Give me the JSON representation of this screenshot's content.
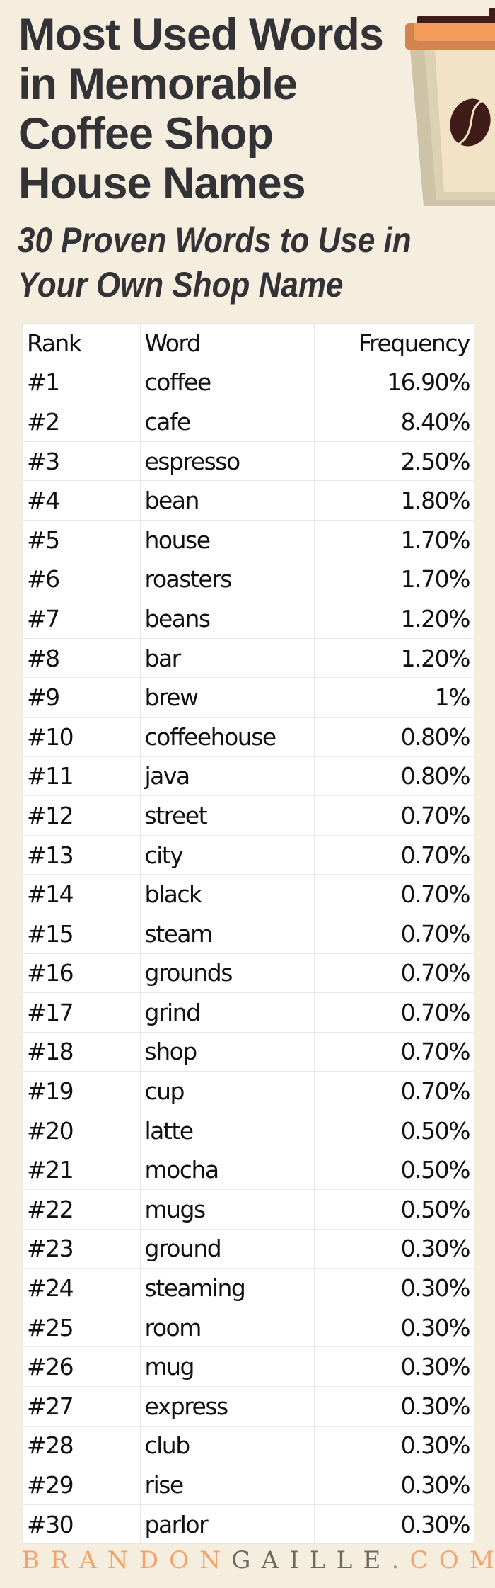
{
  "header": {
    "title_lines": [
      "Most Used Words",
      "in Memorable",
      "Coffee Shop",
      "House Names"
    ],
    "subtitle_lines": [
      "30 Proven Words to Use in",
      "Your Own Shop Name"
    ],
    "illustration": "coffee-cup-icon"
  },
  "colors": {
    "background": "#f5eedf",
    "title": "#333337",
    "accent_orange": "#f4a26b",
    "footer_gray": "#6d6860",
    "bean": "#3f1c17"
  },
  "table": {
    "columns": [
      "Rank",
      "Word",
      "Frequency"
    ],
    "rows": [
      {
        "rank": "#1",
        "word": "coffee",
        "frequency": "16.90%"
      },
      {
        "rank": "#2",
        "word": "cafe",
        "frequency": "8.40%"
      },
      {
        "rank": "#3",
        "word": "espresso",
        "frequency": "2.50%"
      },
      {
        "rank": "#4",
        "word": "bean",
        "frequency": "1.80%"
      },
      {
        "rank": "#5",
        "word": "house",
        "frequency": "1.70%"
      },
      {
        "rank": "#6",
        "word": "roasters",
        "frequency": "1.70%"
      },
      {
        "rank": "#7",
        "word": "beans",
        "frequency": "1.20%"
      },
      {
        "rank": "#8",
        "word": "bar",
        "frequency": "1.20%"
      },
      {
        "rank": "#9",
        "word": "brew",
        "frequency": "1%"
      },
      {
        "rank": "#10",
        "word": "coffeehouse",
        "frequency": "0.80%"
      },
      {
        "rank": "#11",
        "word": "java",
        "frequency": "0.80%"
      },
      {
        "rank": "#12",
        "word": "street",
        "frequency": "0.70%"
      },
      {
        "rank": "#13",
        "word": "city",
        "frequency": "0.70%"
      },
      {
        "rank": "#14",
        "word": "black",
        "frequency": "0.70%"
      },
      {
        "rank": "#15",
        "word": "steam",
        "frequency": "0.70%"
      },
      {
        "rank": "#16",
        "word": "grounds",
        "frequency": "0.70%"
      },
      {
        "rank": "#17",
        "word": "grind",
        "frequency": "0.70%"
      },
      {
        "rank": "#18",
        "word": "shop",
        "frequency": "0.70%"
      },
      {
        "rank": "#19",
        "word": "cup",
        "frequency": "0.70%"
      },
      {
        "rank": "#20",
        "word": "latte",
        "frequency": "0.50%"
      },
      {
        "rank": "#21",
        "word": "mocha",
        "frequency": "0.50%"
      },
      {
        "rank": "#22",
        "word": "mugs",
        "frequency": "0.50%"
      },
      {
        "rank": "#23",
        "word": "ground",
        "frequency": "0.30%"
      },
      {
        "rank": "#24",
        "word": "steaming",
        "frequency": "0.30%"
      },
      {
        "rank": "#25",
        "word": "room",
        "frequency": "0.30%"
      },
      {
        "rank": "#26",
        "word": "mug",
        "frequency": "0.30%"
      },
      {
        "rank": "#27",
        "word": "express",
        "frequency": "0.30%"
      },
      {
        "rank": "#28",
        "word": "club",
        "frequency": "0.30%"
      },
      {
        "rank": "#29",
        "word": "rise",
        "frequency": "0.30%"
      },
      {
        "rank": "#30",
        "word": "parlor",
        "frequency": "0.30%"
      }
    ]
  },
  "footer": {
    "brand_part1": "BRANDON",
    "brand_part2": "GAILLE",
    "dot": ".",
    "brand_part3": "COM"
  }
}
